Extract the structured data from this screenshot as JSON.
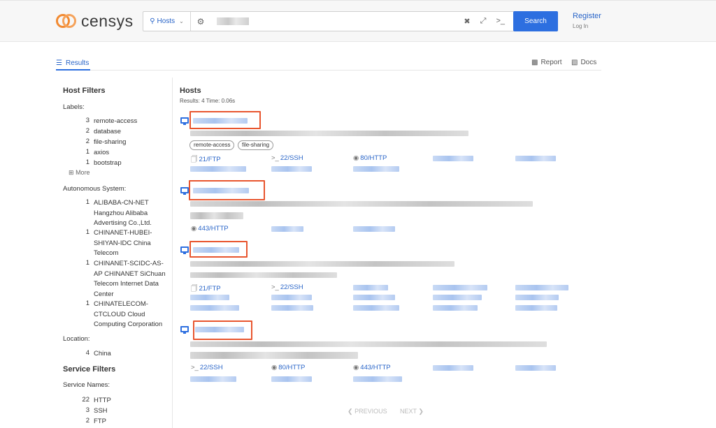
{
  "header": {
    "logo_text": "censys",
    "search_type": "Hosts",
    "search_value": "",
    "search_button": "Search",
    "register": "Register",
    "login": "Log In",
    "icons": [
      "search-icon",
      "caret-down-icon",
      "gear-icon",
      "clear-icon",
      "expand-icon",
      "terminal-icon"
    ]
  },
  "tabs": {
    "results": "Results",
    "report": "Report",
    "docs": "Docs"
  },
  "sidebar": {
    "host_filters": "Host Filters",
    "labels_title": "Labels:",
    "labels": [
      {
        "count": "3",
        "name": "remote-access"
      },
      {
        "count": "2",
        "name": "database"
      },
      {
        "count": "2",
        "name": "file-sharing"
      },
      {
        "count": "1",
        "name": "axios"
      },
      {
        "count": "1",
        "name": "bootstrap"
      }
    ],
    "more": "More",
    "as_title": "Autonomous System:",
    "as": [
      {
        "count": "1",
        "name": "ALIBABA-CN-NET Hangzhou Alibaba Advertising Co.,Ltd."
      },
      {
        "count": "1",
        "name": "CHINANET-HUBEI-SHIYAN-IDC China Telecom"
      },
      {
        "count": "1",
        "name": "CHINANET-SCIDC-AS-AP CHINANET SiChuan Telecom Internet Data Center"
      },
      {
        "count": "1",
        "name": "CHINATELECOM-CTCLOUD Cloud Computing Corporation"
      }
    ],
    "location_title": "Location:",
    "locations": [
      {
        "count": "4",
        "name": "China"
      }
    ],
    "service_filters": "Service Filters",
    "service_names_title": "Service Names:",
    "services": [
      {
        "count": "22",
        "name": "HTTP"
      },
      {
        "count": "3",
        "name": "SSH"
      },
      {
        "count": "2",
        "name": "FTP"
      }
    ]
  },
  "results": {
    "title": "Hosts",
    "meta": "Results: 4   Time: 0.06s",
    "hosts": [
      {
        "labels": [
          "remote-access",
          "file-sharing"
        ],
        "services": [
          "21/FTP",
          "22/SSH",
          "80/HTTP"
        ]
      },
      {
        "labels": [],
        "services": [
          "443/HTTP"
        ]
      },
      {
        "labels": [],
        "services": [
          "21/FTP",
          "22/SSH"
        ]
      },
      {
        "labels": [],
        "services": [
          "22/SSH",
          "80/HTTP",
          "443/HTTP"
        ]
      }
    ]
  },
  "pager": {
    "previous": "PREVIOUS",
    "next": "NEXT"
  },
  "colors": {
    "accent": "#2d6fe0",
    "logo": "#f28a31",
    "highlight": "#e8552e"
  }
}
